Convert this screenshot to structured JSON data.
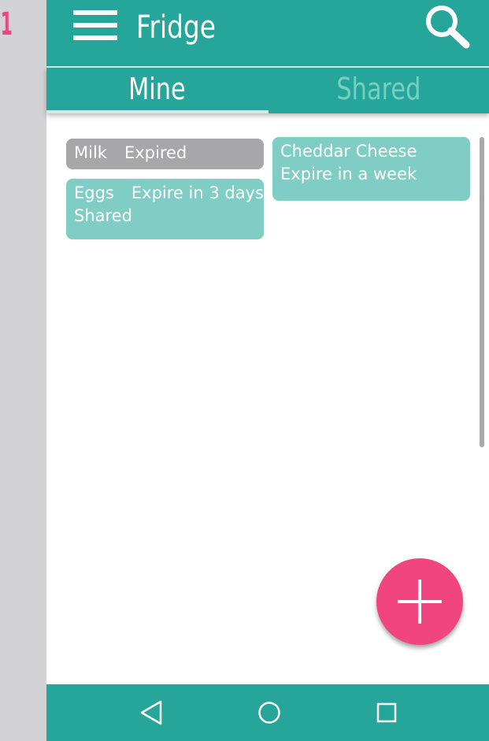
{
  "step_number": "1",
  "appbar": {
    "title": "Fridge",
    "menu_icon": "hamburger-menu-icon",
    "search_icon": "magnifier-search-icon"
  },
  "tabs": [
    {
      "label": "Mine",
      "selected": true
    },
    {
      "label": "Shared",
      "selected": false
    }
  ],
  "items": {
    "milk": {
      "name": "Milk",
      "status": "Expired"
    },
    "eggs": {
      "name": "Eggs",
      "status": "Expire in 3 days",
      "note": "Shared"
    },
    "cheese": {
      "name": "Cheddar Cheese",
      "status": "Expire in a week"
    }
  },
  "fab": {
    "icon": "plus-icon"
  },
  "navbar": {
    "back_icon": "back-triangle-icon",
    "home_icon": "home-circle-icon",
    "recents_icon": "recents-square-icon"
  },
  "colors": {
    "primary": "#26a59a",
    "accent": "#f0457f",
    "item_fresh": "#7fcdc4",
    "item_expired": "#a7a7a9",
    "tab_inactive": "#76cfc4"
  }
}
